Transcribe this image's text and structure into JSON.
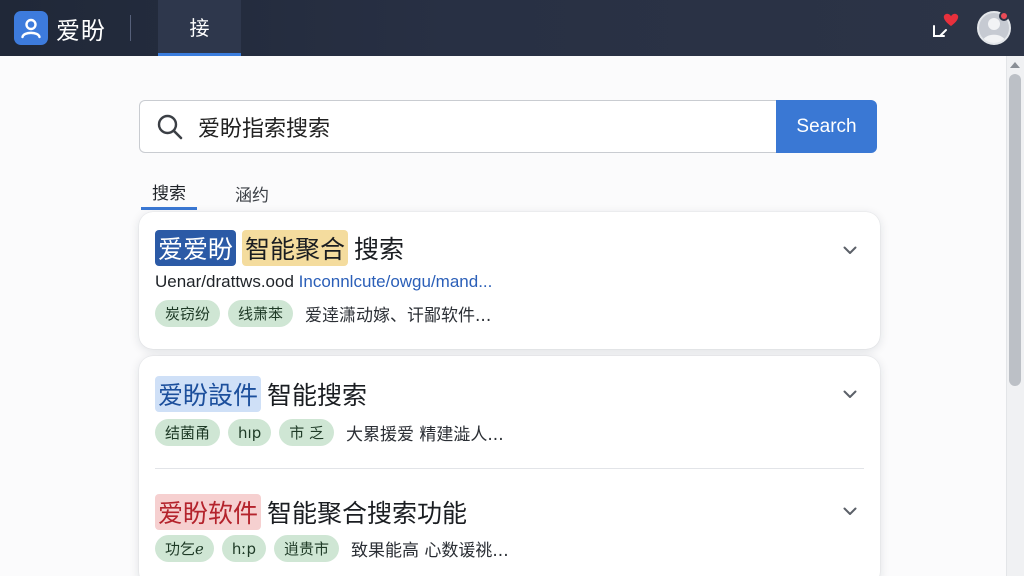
{
  "header": {
    "brand_name": "爱盼",
    "active_tab": "接",
    "icons": {
      "logo": "user-profile-icon",
      "notification": "notification-heart-icon",
      "avatar": "user-avatar-icon"
    }
  },
  "search": {
    "query": "爱盼指索搜索",
    "button_label": "Search"
  },
  "tabs": [
    {
      "label": "搜索",
      "active": true
    },
    {
      "label": "涵约",
      "active": false
    }
  ],
  "results": [
    {
      "title_highlights": [
        "爱爱盼",
        "智能聚合"
      ],
      "title_rest": "搜索",
      "url_plain": "Uenar/drattws.ood",
      "url_link": "Inconnlcute/owgu/mand...",
      "tags": [
        "炭窃纷",
        "线萧苯"
      ],
      "snippet": "爱逹潇动嫁、讦鄙软件..."
    },
    {
      "title_highlights": [
        "爱盼設件"
      ],
      "title_rest": "智能搜索",
      "tags": [
        "结菌甬",
        "hıp",
        "市 乏"
      ],
      "snippet": "大累援爱 精建澁人..."
    },
    {
      "title_highlights": [
        "爱盼软件"
      ],
      "title_rest": "智能聚合搜索功能",
      "tags": [
        "功乞ℯ",
        "hːp",
        "逍贵市"
      ],
      "snippet": "致果能高 心数谖祧..."
    }
  ],
  "colors": {
    "topbar": "#283044",
    "accent": "#3a78d4",
    "tag_bg": "#cfe6d4",
    "link": "#2b5fb8"
  }
}
